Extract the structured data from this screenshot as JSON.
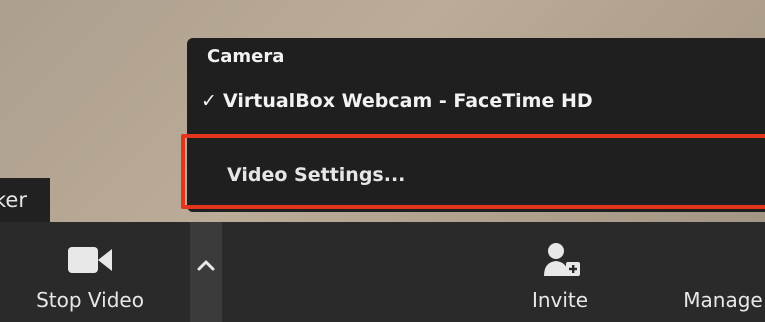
{
  "participant": {
    "name_fragment": "ker"
  },
  "camera_menu": {
    "header": "Camera",
    "selected_camera": {
      "check": "✓",
      "label": "VirtualBox Webcam - FaceTime HD"
    },
    "video_settings_label": "Video Settings..."
  },
  "toolbar": {
    "stop_video_label": "Stop Video",
    "invite_label": "Invite",
    "manage_label": "Manage"
  },
  "colors": {
    "highlight": "#e5341c",
    "menu_bg": "#1f1f1f",
    "toolbar_bg": "#2a2a2a"
  },
  "icons": {
    "camera": "video-camera-icon",
    "caret": "chevron-up-icon",
    "invite": "add-person-icon"
  }
}
